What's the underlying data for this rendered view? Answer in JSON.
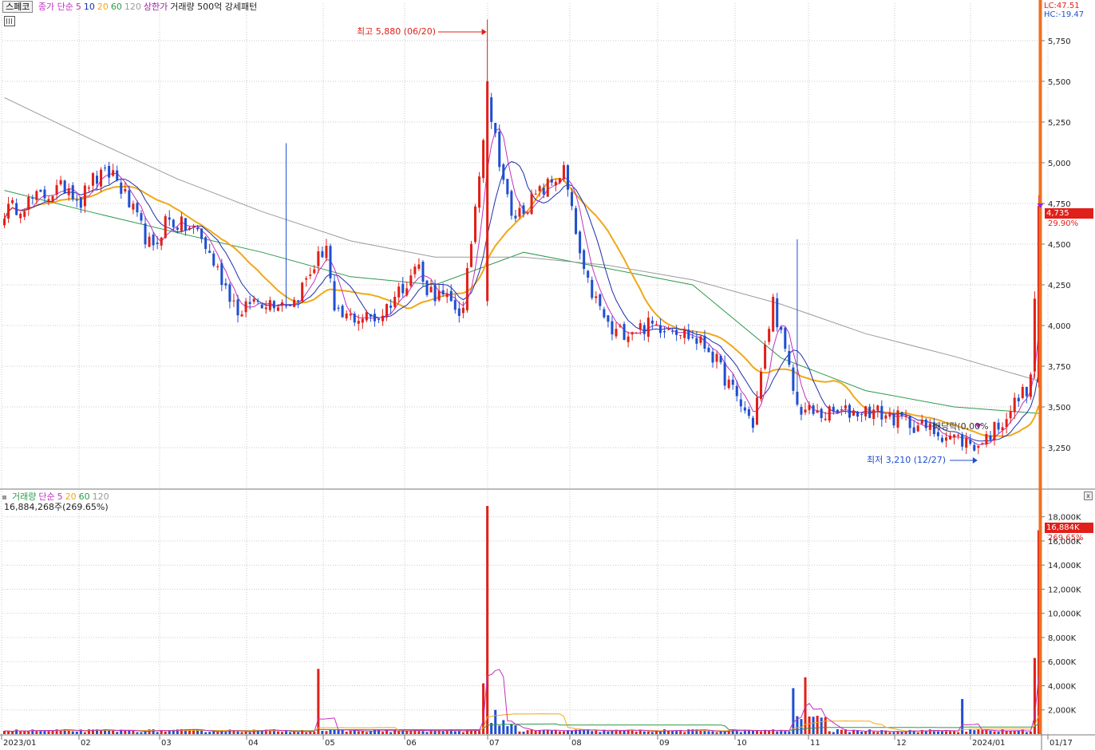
{
  "colors": {
    "up": "#e0201a",
    "down": "#1f4fd0",
    "ma5": "#c030c0",
    "ma10": "#1c2fa8",
    "ma20": "#f0a818",
    "ma60": "#2e9a4a",
    "ma120": "#9a9a9a",
    "current": "#ee7020",
    "grid": "#c9c9c9"
  },
  "price_panel": {
    "stock_name": "스페코",
    "legend": [
      {
        "text": "종가 단순",
        "color": "#c030c0"
      },
      {
        "text": "5",
        "color": "#c030c0"
      },
      {
        "text": "10",
        "color": "#1c2fa8"
      },
      {
        "text": "20",
        "color": "#f0a818"
      },
      {
        "text": "60",
        "color": "#2e9a4a"
      },
      {
        "text": "120",
        "color": "#9a9a9a"
      },
      {
        "text": "상한가",
        "color": "#a020a0"
      },
      {
        "text": "거래량 500억 강세패턴",
        "color": "#222222"
      }
    ],
    "lc_label": "LC:47.51",
    "hc_label": "HC:-19.47",
    "high_annotation": "최고 5,880 (06/20)",
    "low_annotation": "최저 3,210 (12/27)",
    "dividend_label": "배당락(0,00%",
    "current_price_label": "4,735",
    "current_change_label": "29.90%"
  },
  "volume_panel": {
    "legend": [
      {
        "text": "거래량",
        "color": "#2e9a4a"
      },
      {
        "text": "단순",
        "color": "#c030c0"
      },
      {
        "text": "5",
        "color": "#c030c0"
      },
      {
        "text": "20",
        "color": "#f0a818"
      },
      {
        "text": "60",
        "color": "#2e9a4a"
      },
      {
        "text": "120",
        "color": "#9a9a9a"
      }
    ],
    "value_text": "16,884,268주(269.65%)",
    "current_volume_label": "16,884K",
    "current_volume_change": "269.65%"
  },
  "chart_data": [
    {
      "type": "candlestick",
      "title": "",
      "xlabel": "",
      "ylabel": "",
      "ylim": [
        3000,
        5980
      ],
      "y_ticks": [
        3250,
        3500,
        3750,
        4000,
        4250,
        4500,
        4750,
        5000,
        5250,
        5500,
        5750
      ],
      "y_tick_labels": [
        "3,250",
        "3,500",
        "3,750",
        "4,000",
        "4,250",
        "4,500",
        "4,750",
        "5,000",
        "5,250",
        "5,500",
        "5,750"
      ],
      "x_tick_labels": [
        "2023/01",
        "02",
        "03",
        "04",
        "05",
        "06",
        "07",
        "08",
        "09",
        "10",
        "11",
        "12",
        "2024/01",
        "01/17"
      ],
      "grid": true,
      "legend_placement": "top-left",
      "anchors": [
        {
          "date": "2023/01",
          "close": 4700
        },
        {
          "date": "2023/01 mid",
          "close": 4860
        },
        {
          "date": "2023/01 end",
          "close": 4760
        },
        {
          "date": "2023/02",
          "close": 4880
        },
        {
          "date": "2023/02 peak",
          "close": 4940
        },
        {
          "date": "2023/02 late",
          "close": 4450
        },
        {
          "date": "2023/03",
          "close": 4650
        },
        {
          "date": "2023/03 mid",
          "close": 4580
        },
        {
          "date": "2023/03 late",
          "close": 4050
        },
        {
          "date": "2023/04",
          "close": 4150
        },
        {
          "date": "2023/04 mid",
          "close": 4150
        },
        {
          "date": "2023/04 late",
          "close": 4500
        },
        {
          "date": "2023/05",
          "close": 4050
        },
        {
          "date": "2023/05 mid",
          "close": 4050
        },
        {
          "date": "2023/05 late",
          "close": 4380
        },
        {
          "date": "2023/06",
          "close": 4250
        },
        {
          "date": "2023/06 mid",
          "close": 4080
        },
        {
          "date": "2023/06/20",
          "close": 5400
        },
        {
          "date": "2023/06 late",
          "close": 4650
        },
        {
          "date": "2023/07",
          "close": 4700
        },
        {
          "date": "2023/07 mid",
          "close": 4950
        },
        {
          "date": "2023/07 late",
          "close": 4300
        },
        {
          "date": "2023/08",
          "close": 3950
        },
        {
          "date": "2023/08 mid",
          "close": 4000
        },
        {
          "date": "2023/09",
          "close": 4000
        },
        {
          "date": "2023/09 mid",
          "close": 3860
        },
        {
          "date": "2023/09 late",
          "close": 3550
        },
        {
          "date": "2023/10",
          "close": 3400
        },
        {
          "date": "2023/10 mid",
          "close": 4150
        },
        {
          "date": "2023/10 late",
          "close": 3500
        },
        {
          "date": "2023/11",
          "close": 3450
        },
        {
          "date": "2023/11 mid",
          "close": 3480
        },
        {
          "date": "2023/12",
          "close": 3420
        },
        {
          "date": "2023/12/27",
          "close": 3260
        },
        {
          "date": "2024/01",
          "close": 3420
        },
        {
          "date": "2024/01 mid",
          "close": 3650
        },
        {
          "date": "2024/01/17",
          "close": 4735
        }
      ],
      "high": {
        "value": 5880,
        "date": "06/20"
      },
      "low": {
        "value": 3210,
        "date": "12/27"
      },
      "last": {
        "close": 4735,
        "change_pct": 29.9
      },
      "series": [
        {
          "name": "5",
          "color": "#c030c0"
        },
        {
          "name": "10",
          "color": "#1c2fa8"
        },
        {
          "name": "20",
          "color": "#f0a818"
        },
        {
          "name": "60",
          "color": "#2e9a4a",
          "values": [
            4830,
            4700,
            4570,
            4450,
            4300,
            4250,
            4450,
            4350,
            4250,
            3800,
            3600,
            3500,
            3460
          ]
        },
        {
          "name": "120",
          "color": "#9a9a9a",
          "values": [
            5400,
            5150,
            4900,
            4700,
            4520,
            4420,
            4420,
            4370,
            4280,
            4130,
            3950,
            3810,
            3660
          ]
        }
      ]
    },
    {
      "type": "bar",
      "title": "",
      "xlabel": "",
      "ylabel": "",
      "ylim": [
        0,
        19500
      ],
      "y_ticks": [
        2000,
        4000,
        6000,
        8000,
        10000,
        12000,
        14000,
        16000,
        18000
      ],
      "y_tick_labels": [
        "2,000K",
        "4,000K",
        "6,000K",
        "8,000K",
        "10,000K",
        "12,000K",
        "14,000K",
        "16,000K",
        "18,000K"
      ],
      "grid": true,
      "spikes": [
        {
          "date": "2023/04",
          "value": 5400
        },
        {
          "date": "2023/06/19",
          "value": 4200
        },
        {
          "date": "2023/06/20",
          "value": 18900
        },
        {
          "date": "2023/06/22",
          "value": 2000
        },
        {
          "date": "2023/10",
          "value": 3800
        },
        {
          "date": "2023/10 mid",
          "value": 4700
        },
        {
          "date": "2023/12 late",
          "value": 2900
        },
        {
          "date": "2024/01/16",
          "value": 6300
        },
        {
          "date": "2024/01/17",
          "value": 16884
        }
      ],
      "last": {
        "value": 16884,
        "unit": "K",
        "change_pct": 269.65
      },
      "series": [
        {
          "name": "5",
          "color": "#c030c0"
        },
        {
          "name": "20",
          "color": "#f0a818"
        },
        {
          "name": "60",
          "color": "#2e9a4a"
        },
        {
          "name": "120",
          "color": "#9a9a9a"
        }
      ]
    }
  ]
}
